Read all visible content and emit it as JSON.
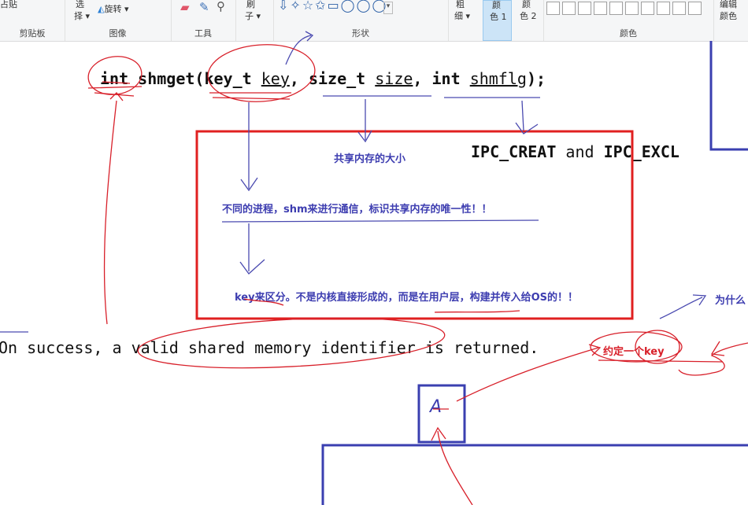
{
  "ribbon": {
    "clipboard": {
      "paste_partial": "占贴",
      "group_label": "剪贴板"
    },
    "image": {
      "select_top": "选",
      "select_bottom": "择",
      "rotate_label": "旋转",
      "group_label": "图像"
    },
    "tools": {
      "group_label": "工具"
    },
    "shapes_partial": {
      "top": "刷",
      "bottom": "子"
    },
    "shapes": {
      "group_label": "形状",
      "glyphs": "⇩✧☆✩▭◯◯◯"
    },
    "size": {
      "top": "粗",
      "bottom": "细"
    },
    "color1": {
      "top": "颜",
      "bottom": "色 1"
    },
    "color2": {
      "top": "颜",
      "bottom": "色 2"
    },
    "colors": {
      "group_label": "颜色"
    },
    "edit_colors": {
      "top": "编辑",
      "bottom": "颜色"
    }
  },
  "code": {
    "kw_int": "int",
    "fn": "shmget(",
    "kw_keyt": "key_t",
    "param_key": "key",
    "comma": ",",
    "kw_sizet": "size_t",
    "param_size": "size",
    "kw_int2": "int",
    "param_flag": "shmflg",
    "close": ");",
    "flags_a": "IPC_CREAT",
    "flags_and": "and",
    "flags_b": "IPC_EXCL",
    "success": "On success, a valid shared memory identifier is returned."
  },
  "annotations": {
    "shared_size": "共享内存的大小",
    "unique": "不同的进程，shm来进行通信，标识共享内存的唯一性！！",
    "key_origin": "key来区分。不是内核直接形成的，而是在用户层，构建并传入给OS的！！",
    "why": "为什么",
    "agree_key": "约定一个key",
    "letter_a": "A"
  },
  "colors": {
    "ink_red": "#d8202a",
    "ink_blue": "#3d3db0",
    "box_blue": "#3a3fb0",
    "ribbon_bg": "#f5f6f7"
  }
}
